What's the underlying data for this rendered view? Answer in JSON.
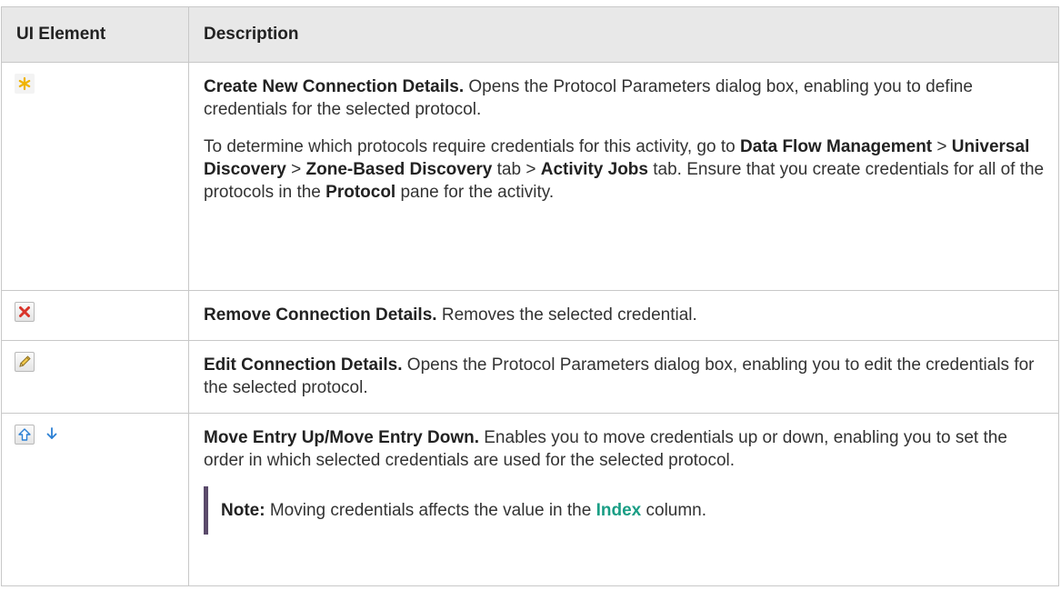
{
  "headers": {
    "ui_element": "UI Element",
    "description": "Description"
  },
  "rows": [
    {
      "icon": "star-new-icon",
      "title": "Create New Connection Details.",
      "text": " Opens the Protocol Parameters dialog box, enabling you to define credentials for the selected protocol.",
      "para2": {
        "t1": "To determine which protocols require credentials for this activity, go to ",
        "b1": "Data Flow Management",
        "t2": " > ",
        "b2": "Universal Discovery",
        "t3": " > ",
        "b3": "Zone-Based Discovery",
        "t4": " tab > ",
        "b4": "Activity Jobs",
        "t5": " tab. Ensure that you create credentials for all of the protocols in the ",
        "b5": "Protocol",
        "t6": " pane for the activity."
      }
    },
    {
      "icon": "remove-x-icon",
      "title": "Remove Connection Details.",
      "text": " Removes the selected credential."
    },
    {
      "icon": "pencil-edit-icon",
      "title": "Edit Connection Details.",
      "text": " Opens the Protocol Parameters dialog box, enabling you to edit the credentials for the selected protocol."
    },
    {
      "icon": "move-up-down-icons",
      "title": "Move Entry Up/Move Entry Down.",
      "text": " Enables you to move credentials up or down, enabling you to set the order in which selected credentials are used for the selected protocol.",
      "note": {
        "label": "Note:",
        "t1": " Moving credentials affects the value in the ",
        "link": "Index",
        "t2": " column."
      }
    }
  ],
  "colors": {
    "header_bg": "#e8e8e8",
    "border": "#c8c8c8",
    "note_bar": "#5a4a6b",
    "accent": "#1a9e85"
  }
}
